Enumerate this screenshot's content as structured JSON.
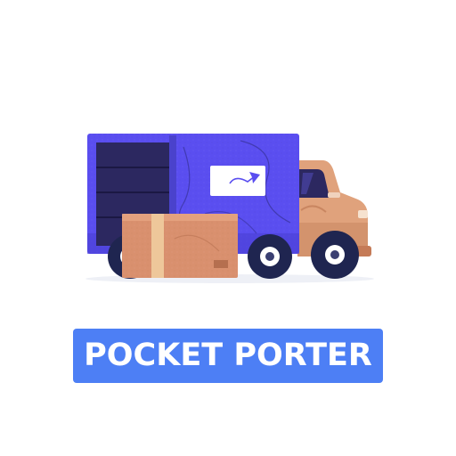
{
  "logo": {
    "brand_name": "POCKET PORTER",
    "illustration": "delivery-truck-with-parcel",
    "icons": [
      "truck-icon",
      "parcel-box-icon",
      "paper-plane-icon"
    ]
  },
  "colors": {
    "background": "#ffffff",
    "banner": "#4d7ff5",
    "banner_text": "#ffffff",
    "cargo_body": "#5a4ef0",
    "cargo_door": "#2c2860",
    "cab": "#e0a27c",
    "box": "#d9906e",
    "box_tape": "#eec79a",
    "wheel": "#1f2550",
    "hubcap": "#ffffff"
  }
}
